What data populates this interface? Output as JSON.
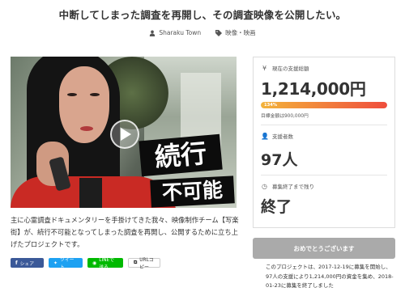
{
  "project": {
    "title": "中断してしまった調査を再開し、その調査映像を公開したい。",
    "owner": "Sharaku Town",
    "category": "映像・映画",
    "description": "主に心霊調査ドキュメンタリーを手掛けてきた我々、映像制作チーム【写楽街】が、続行不可能となってしまった調査を再開し、公開するために立ち上げたプロジェクトです。"
  },
  "video": {
    "caption_line1": "続行",
    "caption_line2": "不可能"
  },
  "share": {
    "facebook": "シェア",
    "twitter": "ツイート",
    "line": "LINEで送る",
    "url": "URLコピー"
  },
  "stats": {
    "funding_label": "現在の支援総額",
    "funding_amount": "1,214,000円",
    "progress_percent": 134,
    "progress_label": "134%",
    "goal_text": "目標金額は900,000円",
    "supporters_label": "支援者数",
    "supporters_count": "97人",
    "remaining_label": "募集終了まで残り",
    "remaining_value": "終了"
  },
  "cta_label": "おめでとうございます",
  "closing_note": "このプロジェクトは、2017-12-19に募集を開始し、97人の支援により1,214,000円の資金を集め、2018-01-23に募集を終了しました",
  "colors": {
    "progress_start": "#f3b33b",
    "progress_end": "#ef4d3c",
    "facebook": "#3b5998",
    "twitter": "#1da1f2",
    "line": "#00b900"
  },
  "icons": {
    "owner": "person-icon",
    "category": "tag-icon",
    "funding": "yen-icon",
    "supporters": "person-icon",
    "remaining": "clock-icon",
    "play": "play-icon"
  }
}
